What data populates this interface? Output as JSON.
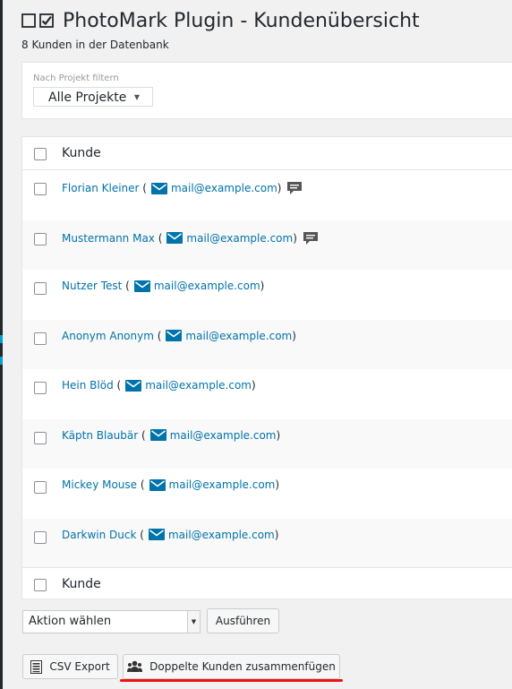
{
  "header": {
    "title": "PhotoMark Plugin - Kundenübersicht",
    "subtitle": "8 Kunden in der Datenbank"
  },
  "filter": {
    "label": "Nach Projekt filtern",
    "selected": "Alle Projekte"
  },
  "table": {
    "column_header": "Kunde",
    "column_footer": "Kunde",
    "rows": [
      {
        "name": "Florian Kleiner",
        "email": "mail@example.com",
        "has_note": true
      },
      {
        "name": "Mustermann Max",
        "email": "mail@example.com",
        "has_note": true
      },
      {
        "name": "Nutzer Test",
        "email": "mail@example.com",
        "has_note": false
      },
      {
        "name": "Anonym Anonym",
        "email": "mail@example.com",
        "has_note": false
      },
      {
        "name": "Hein Blöd",
        "email": "mail@example.com",
        "has_note": false
      },
      {
        "name": "Käptn Blaubär",
        "email": "mail@example.com",
        "has_note": false
      },
      {
        "name": "Mickey Mouse",
        "email": "mail@example.com",
        "has_note": false
      },
      {
        "name": "Darkwin Duck",
        "email": "mail@example.com",
        "has_note": false
      }
    ]
  },
  "bulk": {
    "select_value": "Aktion wählen",
    "apply_label": "Ausführen"
  },
  "buttons": {
    "csv_label": "CSV Export",
    "merge_label": "Doppelte Kunden zusammenfügen"
  },
  "icons": {
    "checkbox": "checkbox-icon",
    "check": "checkmark-icon",
    "mail": "envelope-icon",
    "note": "comment-icon",
    "csv": "spreadsheet-icon",
    "merge": "users-group-icon"
  },
  "colors": {
    "link": "#0073aa",
    "highlight": "#e11111",
    "admin_bar": "#23282d"
  }
}
